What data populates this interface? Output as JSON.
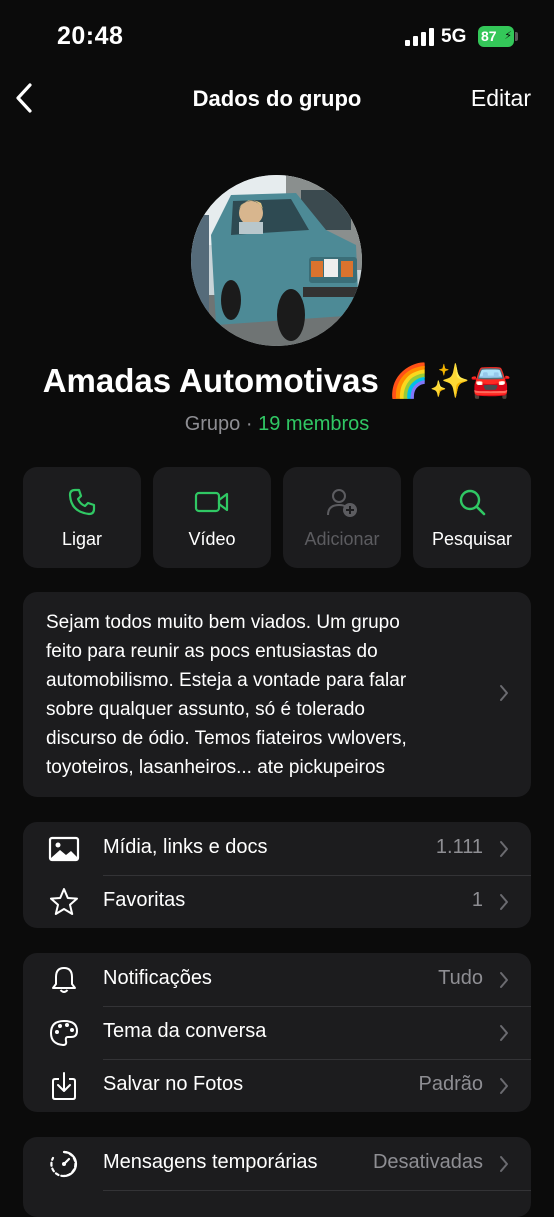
{
  "status_bar": {
    "time": "20:48",
    "network": "5G",
    "battery": "87"
  },
  "nav": {
    "title": "Dados do grupo",
    "edit_label": "Editar"
  },
  "group": {
    "name": "Amadas Automotivas 🌈✨🚘",
    "type": "Grupo",
    "separator": "·",
    "members": "19 membros"
  },
  "actions": [
    {
      "label": "Ligar",
      "icon": "phone-icon",
      "enabled": true
    },
    {
      "label": "Vídeo",
      "icon": "video-camera-icon",
      "enabled": true
    },
    {
      "label": "Adicionar",
      "icon": "add-person-icon",
      "enabled": false
    },
    {
      "label": "Pesquisar",
      "icon": "search-icon",
      "enabled": true
    }
  ],
  "description": {
    "lines": [
      "Sejam todos muito bem viados. Um grupo",
      "feito para reunir as pocs entusiastas do",
      "automobilismo.  Esteja a vontade para falar",
      "sobre qualquer assunto, só é tolerado",
      "discurso de ódio.  Temos fiateiros  vwlovers,",
      "toyoteiros, lasanheiros... ate pickupeiros"
    ]
  },
  "media_section": [
    {
      "label": "Mídia, links e docs",
      "value": "1.111",
      "icon": "photo-icon"
    },
    {
      "label": "Favoritas",
      "value": "1",
      "icon": "star-icon"
    }
  ],
  "settings_section": [
    {
      "label": "Notificações",
      "value": "Tudo",
      "icon": "bell-icon"
    },
    {
      "label": "Tema da conversa",
      "value": "",
      "icon": "palette-icon"
    },
    {
      "label": "Salvar no Fotos",
      "value": "Padrão",
      "icon": "download-icon"
    }
  ],
  "disappearing_section": [
    {
      "label": "Mensagens temporárias",
      "value": "Desativadas",
      "icon": "timer-icon"
    }
  ],
  "colors": {
    "accent_green": "#30c864",
    "card_bg": "#1c1c1e",
    "background": "#0b0b0b",
    "secondary_text": "#8e8e93"
  }
}
